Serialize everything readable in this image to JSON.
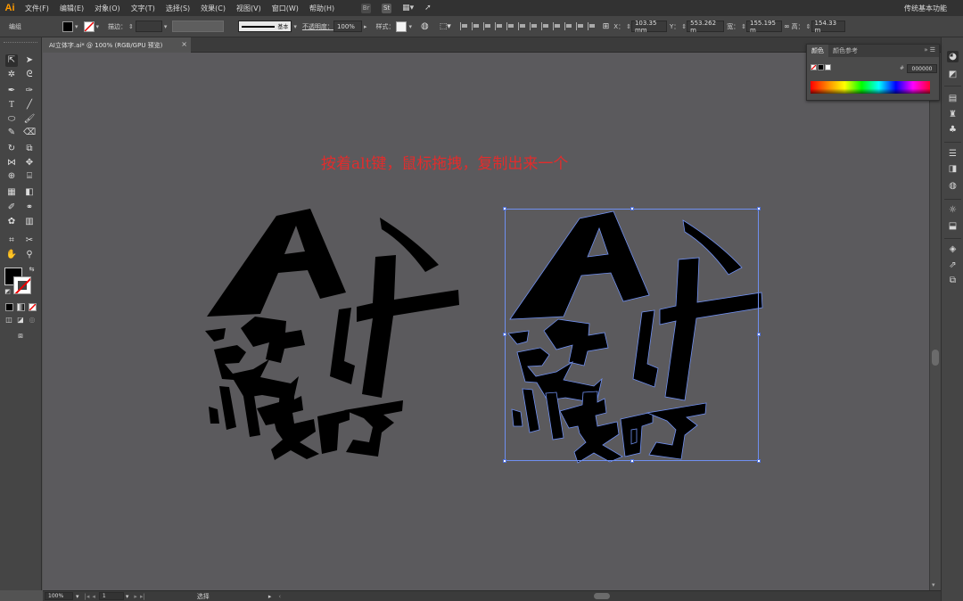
{
  "app": {
    "logo": "Ai",
    "menu": [
      "文件(F)",
      "编辑(E)",
      "对象(O)",
      "文字(T)",
      "选择(S)",
      "效果(C)",
      "视图(V)",
      "窗口(W)",
      "帮助(H)"
    ],
    "bridge_icon": "Br",
    "stock_icon": "St",
    "workspace": "传统基本功能"
  },
  "controlbar": {
    "group_label": "编组",
    "stroke_label": "描边：",
    "stroke_style": "基本",
    "opacity_label": "不透明度：",
    "opacity_value": "100%",
    "style_label": "样式：",
    "x_label": "X：",
    "x_value": "103.35 mm",
    "y_label": "Y：",
    "y_value": "553.262 m",
    "w_label": "宽：",
    "w_value": "155.195 m",
    "h_label": "高：",
    "h_value": "154.33 m"
  },
  "document": {
    "tab_title": "AI立体字.ai* @ 100% (RGB/GPU 预览)",
    "close_icon": "×"
  },
  "canvas": {
    "annotation": "按着alt键，鼠标拖拽，复制出来一个"
  },
  "color_panel": {
    "tab_color": "颜色",
    "tab_guide": "颜色参考",
    "hex_value": "000000",
    "hash": "#"
  },
  "statusbar": {
    "zoom": "100%",
    "page": "1",
    "tool": "选择"
  },
  "colors": {
    "accent": "#ff9a00",
    "annotation": "#e22c2c",
    "selection": "#6f8ff0",
    "canvas": "#5b5a5d"
  }
}
